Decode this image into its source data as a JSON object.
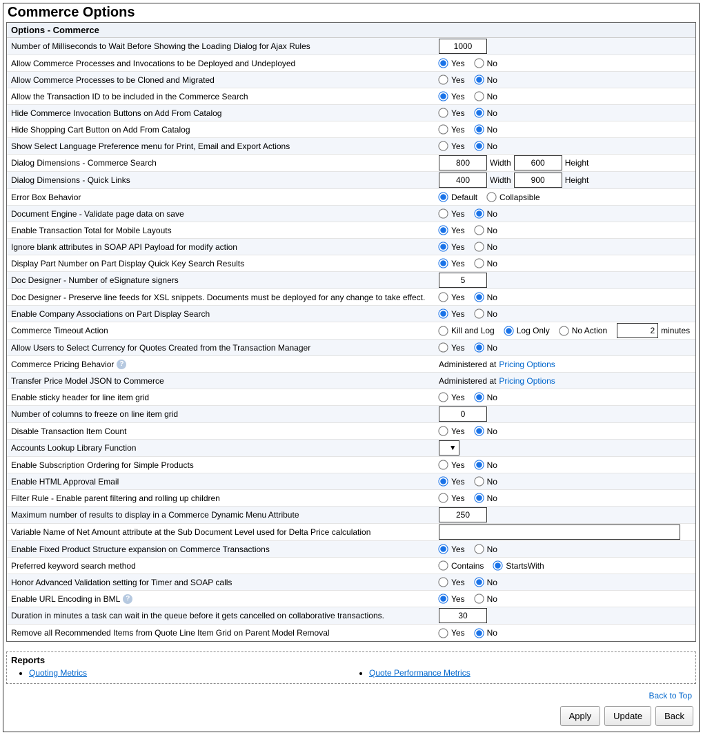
{
  "page_title": "Commerce Options",
  "section_header": "Options - Commerce",
  "yes": "Yes",
  "no": "No",
  "width_lbl": "Width",
  "height_lbl": "Height",
  "admin_prefix": "Administered at ",
  "pricing_link": "Pricing Options",
  "rows": {
    "ms_wait": {
      "label": "Number of Milliseconds to Wait Before Showing the Loading Dialog for Ajax Rules",
      "value": "1000"
    },
    "allow_deploy": {
      "label": "Allow Commerce Processes and Invocations to be Deployed and Undeployed",
      "value": "Yes"
    },
    "allow_clone": {
      "label": "Allow Commerce Processes to be Cloned and Migrated",
      "value": "No"
    },
    "allow_txn_id": {
      "label": "Allow the Transaction ID to be included in the Commerce Search",
      "value": "Yes"
    },
    "hide_invoc": {
      "label": "Hide Commerce Invocation Buttons on Add From Catalog",
      "value": "No"
    },
    "hide_cart": {
      "label": "Hide Shopping Cart Button on Add From Catalog",
      "value": "No"
    },
    "lang_pref": {
      "label": "Show Select Language Preference menu for Print, Email and Export Actions",
      "value": "No"
    },
    "dlg_search": {
      "label": "Dialog Dimensions - Commerce Search",
      "w": "800",
      "h": "600"
    },
    "dlg_quick": {
      "label": "Dialog Dimensions - Quick Links",
      "w": "400",
      "h": "900"
    },
    "errbox": {
      "label": "Error Box Behavior",
      "opt1": "Default",
      "opt2": "Collapsible",
      "value": "Default"
    },
    "doc_eng": {
      "label": "Document Engine - Validate page data on save",
      "value": "No"
    },
    "txn_total": {
      "label": "Enable Transaction Total for Mobile Layouts",
      "value": "Yes"
    },
    "ignore_blank": {
      "label": "Ignore blank attributes in SOAP API Payload for modify action",
      "value": "Yes"
    },
    "part_num": {
      "label": "Display Part Number on Part Display Quick Key Search Results",
      "value": "Yes"
    },
    "esig": {
      "label": "Doc Designer - Number of eSignature signers",
      "value": "5"
    },
    "preserve_lf": {
      "label": "Doc Designer - Preserve line feeds for XSL snippets. Documents must be deployed for any change to take effect.",
      "value": "No"
    },
    "company_assoc": {
      "label": "Enable Company Associations on Part Display Search",
      "value": "Yes"
    },
    "timeout": {
      "label": "Commerce Timeout Action",
      "opt1": "Kill and Log",
      "opt2": "Log Only",
      "opt3": "No Action",
      "value": "Log Only",
      "minutes": "2",
      "minutes_lbl": "minutes"
    },
    "sel_currency": {
      "label": "Allow Users to Select Currency for Quotes Created from the Transaction Manager",
      "value": "No"
    },
    "pricing_beh": {
      "label": "Commerce Pricing Behavior"
    },
    "transfer_pm": {
      "label": "Transfer Price Model JSON to Commerce"
    },
    "sticky": {
      "label": "Enable sticky header for line item grid",
      "value": "No"
    },
    "freeze_cols": {
      "label": "Number of columns to freeze on line item grid",
      "value": "0"
    },
    "disable_count": {
      "label": "Disable Transaction Item Count",
      "value": "No"
    },
    "acct_lookup": {
      "label": "Accounts Lookup Library Function"
    },
    "sub_order": {
      "label": "Enable Subscription Ordering for Simple Products",
      "value": "No"
    },
    "html_approve": {
      "label": "Enable HTML Approval Email",
      "value": "Yes"
    },
    "filter_rule": {
      "label": "Filter Rule - Enable parent filtering and rolling up children",
      "value": "No"
    },
    "max_results": {
      "label": "Maximum number of results to display in a Commerce Dynamic Menu Attribute",
      "value": "250"
    },
    "var_net": {
      "label": "Variable Name of Net Amount attribute at the Sub Document Level used for Delta Price calculation",
      "value": ""
    },
    "fixed_struct": {
      "label": "Enable Fixed Product Structure expansion on Commerce Transactions",
      "value": "Yes"
    },
    "kw_search": {
      "label": "Preferred keyword search method",
      "opt1": "Contains",
      "opt2": "StartsWith",
      "value": "StartsWith"
    },
    "honor_adv": {
      "label": "Honor Advanced Validation setting for Timer and SOAP calls",
      "value": "No"
    },
    "url_enc": {
      "label": "Enable URL Encoding in BML",
      "value": "Yes"
    },
    "queue_wait": {
      "label": "Duration in minutes a task can wait in the queue before it gets cancelled on collaborative transactions.",
      "value": "30"
    },
    "remove_rec": {
      "label": "Remove all Recommended Items from Quote Line Item Grid on Parent Model Removal",
      "value": "No"
    }
  },
  "reports": {
    "header": "Reports",
    "left": "Quoting Metrics",
    "right": "Quote Performance Metrics"
  },
  "back_to_top": "Back to Top",
  "buttons": {
    "apply": "Apply",
    "update": "Update",
    "back": "Back"
  }
}
